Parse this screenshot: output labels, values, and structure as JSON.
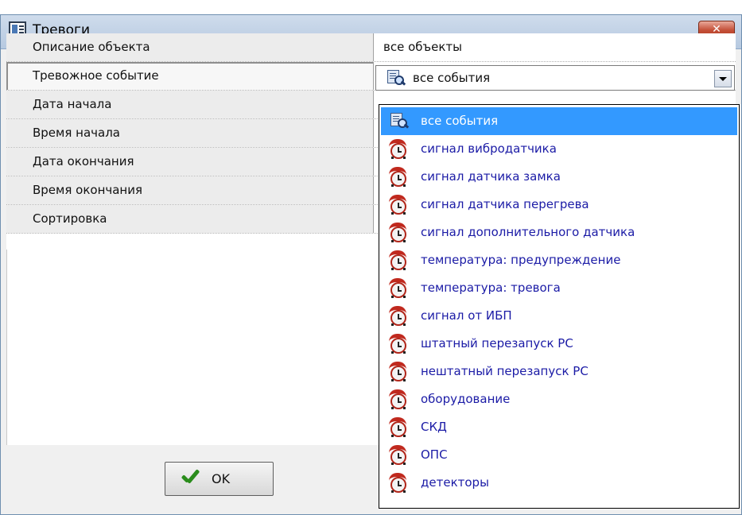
{
  "window": {
    "title": "Тревоги",
    "close_label": "✕"
  },
  "properties": [
    {
      "label": "Описание объекта",
      "value": "все объекты"
    },
    {
      "label": "Тревожное событие",
      "value": ""
    },
    {
      "label": "Дата начала",
      "value": ""
    },
    {
      "label": "Время начала",
      "value": ""
    },
    {
      "label": "Дата окончания",
      "value": ""
    },
    {
      "label": "Время окончания",
      "value": ""
    },
    {
      "label": "Сортировка",
      "value": ""
    }
  ],
  "event_select": {
    "selected": "все события",
    "icon": "search-icon",
    "options": [
      {
        "label": "все события",
        "icon": "search-icon"
      },
      {
        "label": "сигнал вибродатчика",
        "icon": "alarm-clock-icon"
      },
      {
        "label": "сигнал датчика замка",
        "icon": "alarm-clock-icon"
      },
      {
        "label": "сигнал датчика перегрева",
        "icon": "alarm-clock-icon"
      },
      {
        "label": "сигнал дополнительного датчика",
        "icon": "alarm-clock-icon"
      },
      {
        "label": "температура: предупреждение",
        "icon": "alarm-clock-icon"
      },
      {
        "label": "температура: тревога",
        "icon": "alarm-clock-icon"
      },
      {
        "label": "сигнал от ИБП",
        "icon": "alarm-clock-icon"
      },
      {
        "label": "штатный перезапуск PC",
        "icon": "alarm-clock-icon"
      },
      {
        "label": "нештатный перезапуск PC",
        "icon": "alarm-clock-icon"
      },
      {
        "label": "оборудование",
        "icon": "alarm-clock-icon"
      },
      {
        "label": "СКД",
        "icon": "alarm-clock-icon"
      },
      {
        "label": "ОПС",
        "icon": "alarm-clock-icon"
      },
      {
        "label": "детекторы",
        "icon": "alarm-clock-icon"
      }
    ]
  },
  "ok_button": {
    "label": "OK",
    "icon": "checkmark-icon"
  },
  "colors": {
    "selection": "#3399ff",
    "option_text": "#1b1ba6",
    "close_button": "#c45038"
  }
}
